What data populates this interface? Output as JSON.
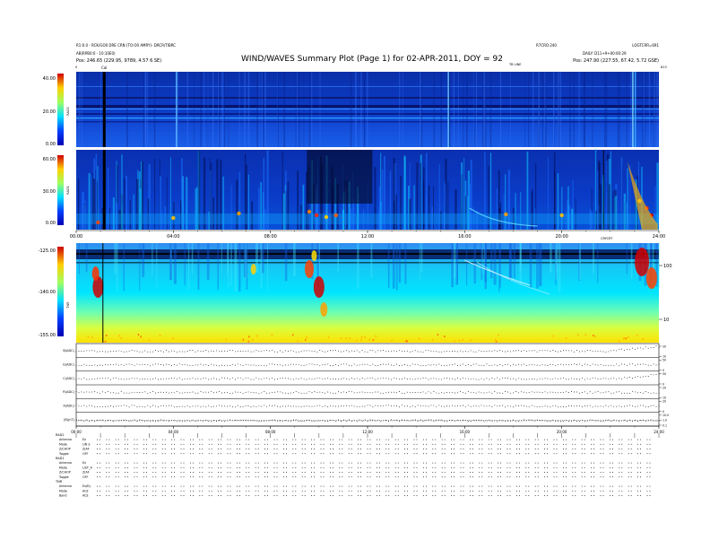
{
  "header": {
    "left_line1": "R1:0.0 - RCK/GO0 DRE CRN (TO:O0 AMRY)- DRCR/TIBRC",
    "left_line2": "AB(RPB0:0 - 10:10E0)",
    "left_line3": "Pos:   246.65 (229.95, 9789, 4.57 6.SE)",
    "title": "WIND/WAVES Summary Plot (Page 1) for 02-APR-2011, DOY = 92",
    "right_line1": "R7CRO:240",
    "right_line2": "LOGTCRR=691",
    "right_line3": "DAILY: D11+9+00:00:29",
    "right_line4": "Pos:   247.90 (227.55, 67.42, 5.72 GSE)",
    "tb_label": "TB LINE",
    "cal_label": "Cal",
    "small_left_tick": "0",
    "small_right_tick": "813"
  },
  "chart_data": [
    {
      "type": "heatmap",
      "panel": "RAD2",
      "ylabel": "RAD2",
      "yticks": [
        "40.00",
        "20.00",
        "0.00"
      ],
      "ylim": [
        0,
        40
      ]
    },
    {
      "type": "heatmap",
      "panel": "RAD1",
      "ylabel": "RAD1",
      "yticks": [
        "60.00",
        "30.00",
        "0.00"
      ],
      "ylim": [
        0,
        60
      ],
      "xticks": [
        "00:00",
        "04:00",
        "08:00",
        "12:00",
        "16:00",
        "20:00",
        "24:00"
      ],
      "xlim": [
        0,
        24
      ]
    },
    {
      "type": "heatmap",
      "panel": "TNR",
      "ylabel": "TNR",
      "yticks": [
        "-125.00",
        "-140.00",
        "-155.00"
      ],
      "ylim": [
        -155,
        -125
      ],
      "right_label": "CRYCRT",
      "right_ticks": [
        "100",
        "10"
      ]
    },
    {
      "type": "line",
      "panel": "lines",
      "rows": [
        {
          "label": "B(ADC)",
          "right_ticks": [
            "20",
            "10"
          ]
        },
        {
          "label": "G(ADC)",
          "right_ticks": [
            "50",
            "0"
          ]
        },
        {
          "label": "C(ADC)",
          "right_ticks": [
            "50",
            "0"
          ]
        },
        {
          "label": "R(ADC)",
          "right_ticks": [
            "20",
            "10"
          ]
        },
        {
          "label": "X(ADC)",
          "right_ticks": [
            "20",
            "0"
          ]
        },
        {
          "label": "|B|(nT)",
          "right_ticks": [
            "10.0",
            "1.0",
            "0.1"
          ]
        }
      ],
      "xticks": [
        "00:00",
        "04:00",
        "08:00",
        "12:00",
        "16:00",
        "20:00",
        "24:00"
      ],
      "xlim": [
        0,
        24
      ]
    }
  ],
  "footer": {
    "blocks": [
      {
        "head": "RAD2",
        "lines": [
          {
            "k": "Antenna",
            "v": "Ex"
          },
          {
            "k": "Mode",
            "v": "LIN S"
          },
          {
            "k": "Z/CHOP",
            "v": "Z(AF"
          },
          {
            "k": "Toggle",
            "v": "OFF"
          }
        ]
      },
      {
        "head": "RAD1",
        "lines": [
          {
            "k": "Antenna",
            "v": "Ex"
          },
          {
            "k": "Mode",
            "v": "LIST_A"
          },
          {
            "k": "Z/CHOP",
            "v": "Z(AF"
          },
          {
            "k": "Toggle",
            "v": "OFF"
          }
        ]
      },
      {
        "head": "TNR",
        "lines": [
          {
            "k": "Antenna",
            "v": "Ex/Ey"
          },
          {
            "k": "Mode",
            "v": "ACE"
          },
          {
            "k": "Band",
            "v": "ACE"
          }
        ]
      }
    ]
  }
}
